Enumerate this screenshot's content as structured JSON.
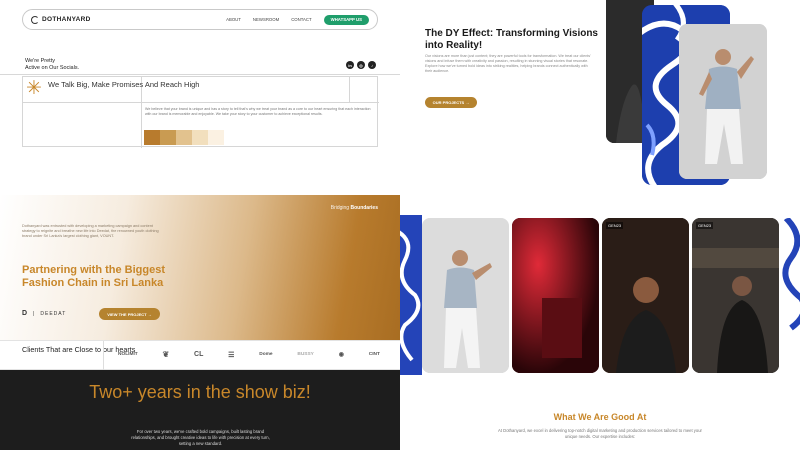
{
  "nav": {
    "logo": "DOTHANYARD",
    "links": [
      "ABOUT",
      "NEWSROOM",
      "CONTACT"
    ],
    "cta": "WHATSAPP US"
  },
  "social": {
    "line1": "We're Pretty",
    "line2": "Active on Our Socials.",
    "icons": [
      "linkedin-icon",
      "instagram-icon",
      "tiktok-icon"
    ]
  },
  "promise": {
    "heading": "We Talk Big, Make Promises And Reach High",
    "description": "We believe that your brand is unique and has a story to tell that's why we treat your brand as a core to our heart ensuring that each interaction with our brand is memorable and enjoyable. We take your story to your customer to achieve exceptional results.",
    "swatches": [
      "#b87b2d",
      "#c99b52",
      "#e2c28e",
      "#f2dfbd",
      "#fbf1e2"
    ]
  },
  "dy": {
    "title": "The DY Effect: Transforming Visions into Reality!",
    "text": "Our visions are more than just content; they are powerful tools for transformation. We treat our clients' visions and infuse them with creativity and passion, resulting in stunning visual stories that resonate. Explore how we've turned bold ideas into striking realities, helping brands connect authentically with their audience.",
    "button": "OUR PROJECTS →"
  },
  "partner": {
    "bridging_light": "Bridging",
    "bridging_bold": "Boundaries",
    "text": "Dothanyard was entrusted with developing a marketing campaign and content strategy to reignite and breathe new life into Deedat, the renowned youth clothing brand under Sri Lanka's largest clothing giant, VOUNT.",
    "heading": "Partnering with the Biggest Fashion Chain in Sri Lanka",
    "brand": "DEEDAT",
    "button": "VIEW THE PROJECT →"
  },
  "clients": {
    "title": "Clients That are Close to our hearts",
    "logos": [
      "NOLIMIT",
      "❦",
      "CL",
      "☰",
      "Dome",
      "BUSSY",
      "◉",
      "CINT"
    ]
  },
  "years": {
    "heading": "Two+ years in the show biz!",
    "text": "For over two years, we've crafted bold campaigns, built lasting brand relationships, and brought creative ideas to life with precision at every turn, setting a new standard."
  },
  "good": {
    "title": "What We Are Good At",
    "text": "At Dothanyard, we excel in delivering top-notch digital marketing and production services tailored to meet your unique needs. Our expertise includes:"
  },
  "tiles": {
    "label": "GEN23"
  },
  "colors": {
    "gold": "#c8872a",
    "green": "#1f9e6b",
    "blue": "#2444b8",
    "dark": "#1d1d1d"
  }
}
